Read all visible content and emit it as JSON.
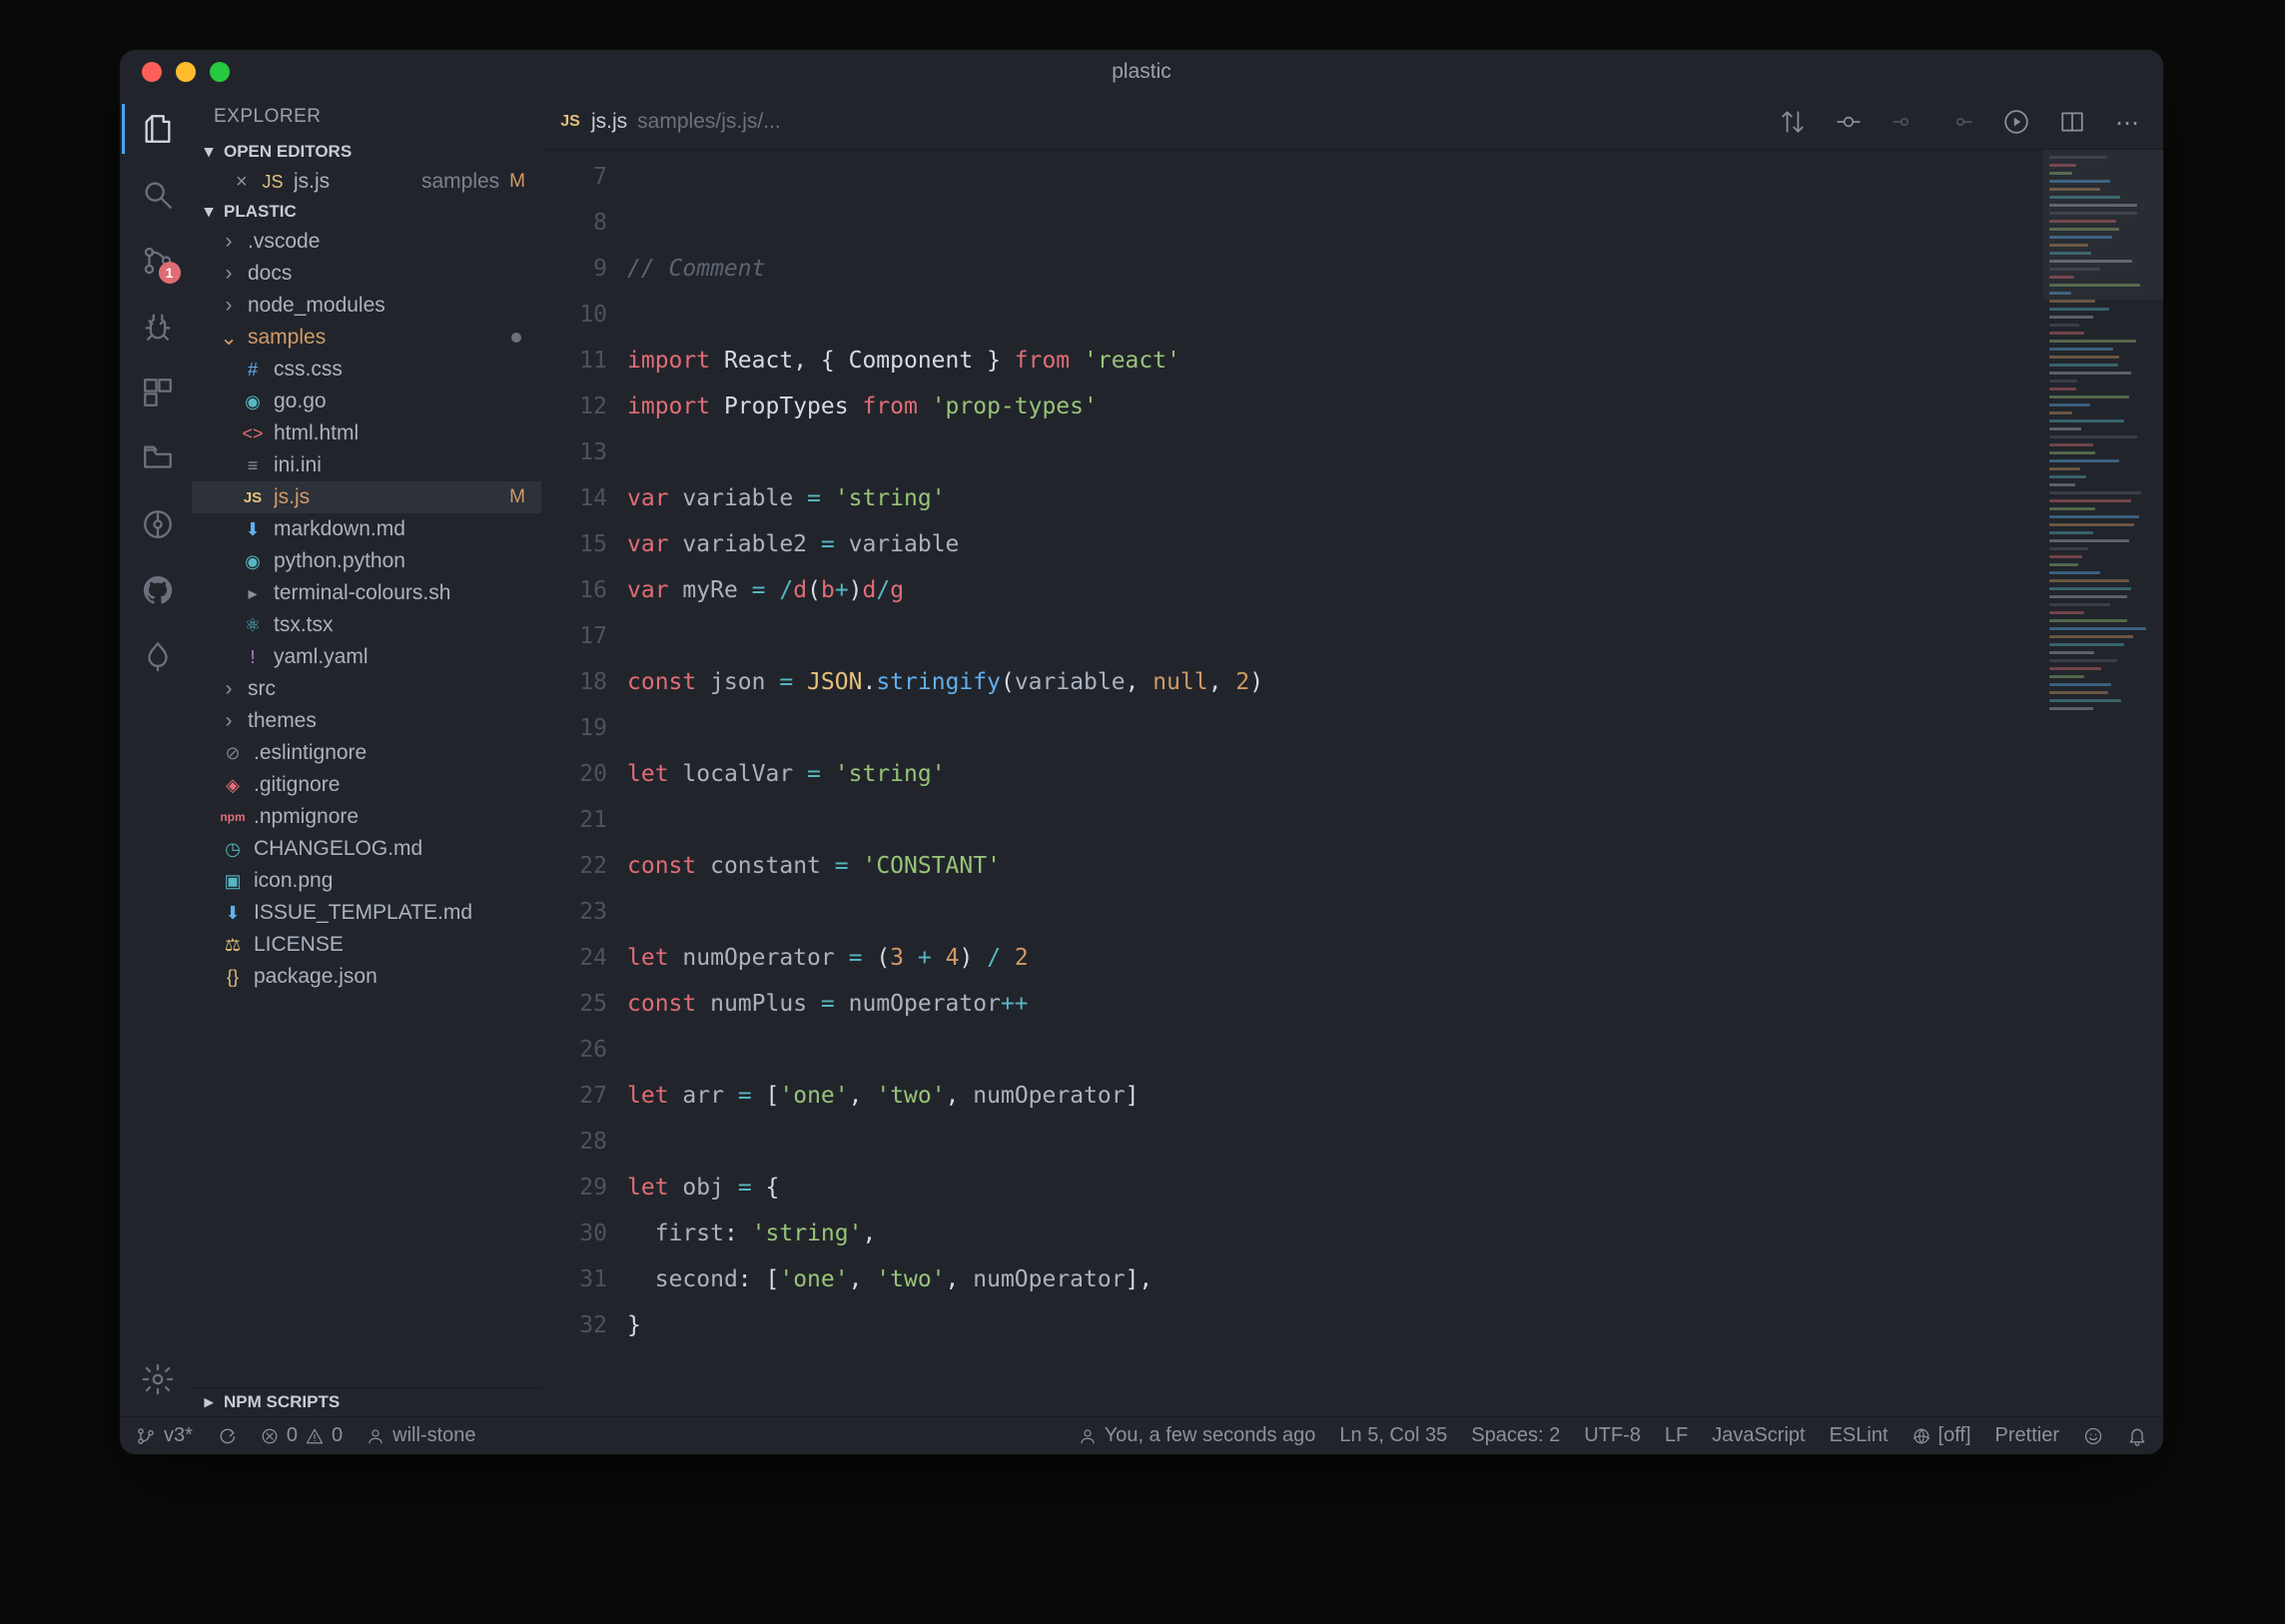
{
  "window": {
    "title": "plastic"
  },
  "activitybar": {
    "source_control_badge": "1"
  },
  "sidebar": {
    "title": "EXPLORER",
    "open_editors_label": "OPEN EDITORS",
    "open_editor": {
      "name": "js.js",
      "dir": "samples",
      "badge": "M"
    },
    "workspace_label": "PLASTIC",
    "tree": {
      "vscode": ".vscode",
      "docs": "docs",
      "node_modules": "node_modules",
      "samples": "samples",
      "samples_children": {
        "css": "css.css",
        "go": "go.go",
        "html": "html.html",
        "ini": "ini.ini",
        "js": "js.js",
        "js_badge": "M",
        "markdown": "markdown.md",
        "python": "python.python",
        "terminal": "terminal-colours.sh",
        "tsx": "tsx.tsx",
        "yaml": "yaml.yaml"
      },
      "src": "src",
      "themes": "themes",
      "eslintignore": ".eslintignore",
      "gitignore": ".gitignore",
      "npmignore": ".npmignore",
      "changelog": "CHANGELOG.md",
      "icon": "icon.png",
      "issue_template": "ISSUE_TEMPLATE.md",
      "license": "LICENSE",
      "package": "package.json"
    },
    "npm_scripts_label": "NPM SCRIPTS"
  },
  "tab": {
    "filename": "js.js",
    "breadcrumb": "samples/js.js/..."
  },
  "gutter": {
    "lines": [
      "7",
      "8",
      "9",
      "10",
      "11",
      "12",
      "13",
      "14",
      "15",
      "16",
      "17",
      "18",
      "19",
      "20",
      "21",
      "22",
      "23",
      "24",
      "25",
      "26",
      "27",
      "28",
      "29",
      "30",
      "31",
      "32"
    ]
  },
  "code": {
    "l7": "",
    "l8_comment": "// Comment",
    "l9": "",
    "l10": {
      "import": "import",
      "react": "React",
      "comp": "Component",
      "from": "from",
      "pkg": "'react'"
    },
    "l11": {
      "import": "import",
      "pt": "PropTypes",
      "from": "from",
      "pkg": "'prop-types'"
    },
    "l12": "",
    "l13": {
      "var": "var",
      "name": "variable",
      "eq": "=",
      "str": "'string'"
    },
    "l14": {
      "var": "var",
      "name": "variable2",
      "eq": "=",
      "rhs": "variable"
    },
    "l15": {
      "var": "var",
      "name": "myRe",
      "eq": "=",
      "regex": "/d(b+)d/g"
    },
    "l16": "",
    "l17": {
      "const": "const",
      "name": "json",
      "eq": "=",
      "obj": "JSON",
      "dot": ".",
      "fn": "stringify",
      "args_v": "variable",
      "args_n": "null",
      "args_2": "2"
    },
    "l18": "",
    "l19": {
      "let": "let",
      "name": "localVar",
      "eq": "=",
      "str": "'string'"
    },
    "l20": "",
    "l21": {
      "const": "const",
      "name": "constant",
      "eq": "=",
      "str": "'CONSTANT'"
    },
    "l22": "",
    "l23": {
      "let": "let",
      "name": "numOperator",
      "eq": "=",
      "n1": "3",
      "plus": "+",
      "n2": "4",
      "div": "/",
      "n3": "2"
    },
    "l24": {
      "const": "const",
      "name": "numPlus",
      "eq": "=",
      "rhs": "numOperator",
      "inc": "++"
    },
    "l25": "",
    "l26": {
      "let": "let",
      "name": "arr",
      "eq": "=",
      "s1": "'one'",
      "s2": "'two'",
      "rhs": "numOperator"
    },
    "l27": "",
    "l28": {
      "let": "let",
      "name": "obj",
      "eq": "="
    },
    "l29": {
      "key": "first",
      "str": "'string'"
    },
    "l30": {
      "key": "second",
      "s1": "'one'",
      "s2": "'two'",
      "rhs": "numOperator"
    },
    "l31": "}",
    "l32": ""
  },
  "status": {
    "branch": "v3*",
    "errors": "0",
    "warnings": "0",
    "user": "will-stone",
    "blame": "You, a few seconds ago",
    "pos": "Ln 5, Col 35",
    "spaces": "Spaces: 2",
    "enc": "UTF-8",
    "eol": "LF",
    "lang": "JavaScript",
    "eslint": "ESLint",
    "off": "[off]",
    "prettier": "Prettier"
  }
}
